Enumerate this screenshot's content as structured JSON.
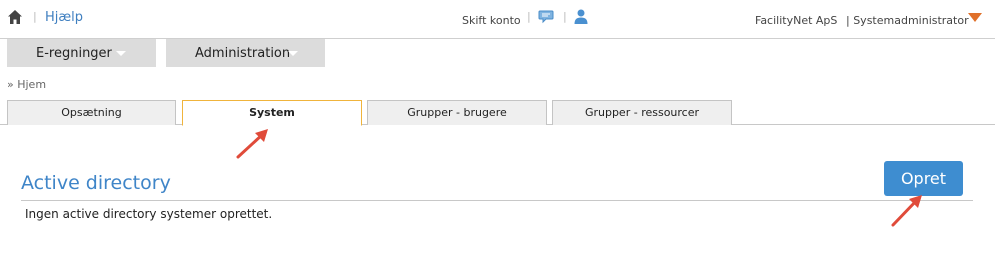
{
  "header": {
    "help_label": "Hjælp",
    "separator": "|",
    "switch_account_label": "Skift konto",
    "company_name": "FacilityNet ApS",
    "user_role": "| Systemadministrator",
    "icons": [
      "home-icon",
      "chat-icon",
      "user-icon",
      "chevron-down-icon"
    ],
    "accent_color": "#e0702a"
  },
  "menu": {
    "items": [
      {
        "label": "E-regninger"
      },
      {
        "label": "Administration"
      }
    ]
  },
  "breadcrumb": {
    "text": "» Hjem"
  },
  "tabs": [
    {
      "label": "Opsætning",
      "active": false
    },
    {
      "label": "System",
      "active": true
    },
    {
      "label": "Grupper - brugere",
      "active": false
    },
    {
      "label": "Grupper - ressourcer",
      "active": false
    }
  ],
  "section": {
    "title": "Active directory",
    "create_button_label": "Opret",
    "empty_message": "Ingen active directory systemer oprettet."
  },
  "colors": {
    "link_blue": "#3f7fc0",
    "title_blue": "#3f85c8",
    "button_blue": "#3e8dd0",
    "active_tab_border": "#f0b43c",
    "annotation_arrow": "#e04b3a"
  }
}
